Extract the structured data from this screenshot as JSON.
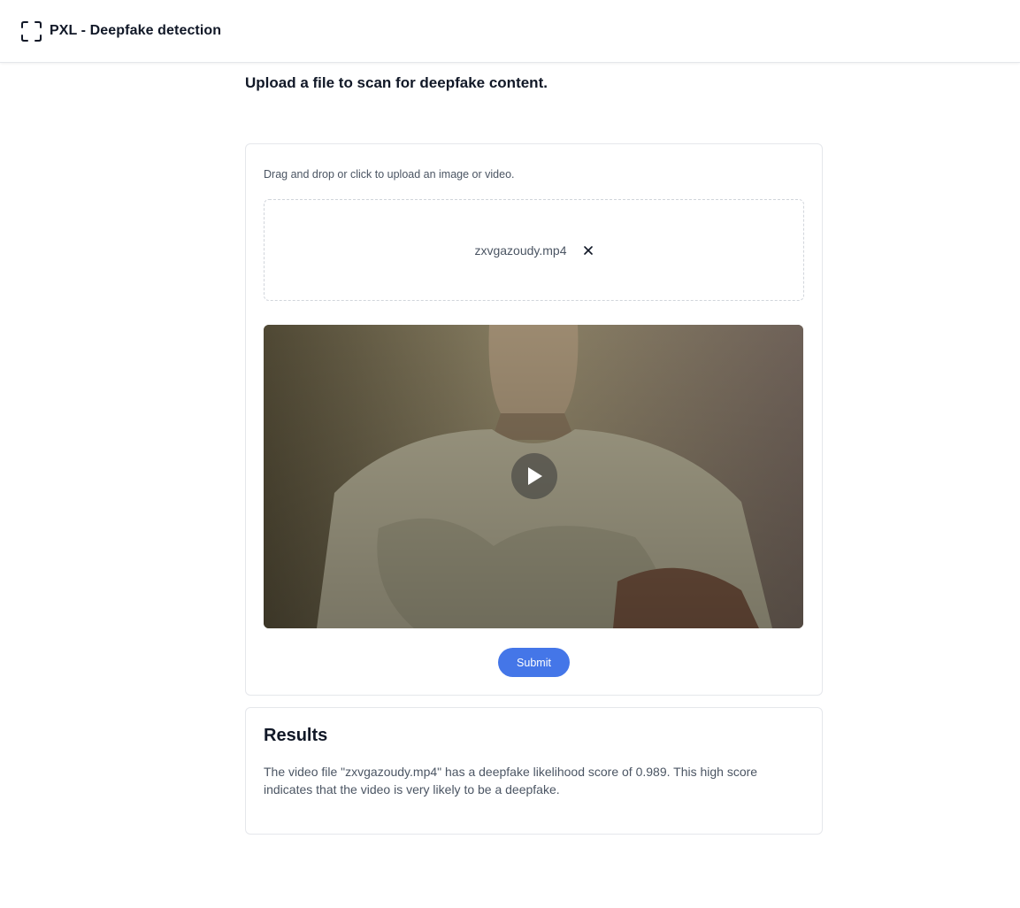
{
  "header": {
    "app_title": "PXL - Deepfake detection",
    "logo_icon": "scan-frame-icon"
  },
  "main": {
    "heading": "Upload a file to scan for deepfake content."
  },
  "upload": {
    "hint": "Drag and drop or click to upload an image or video.",
    "file_name": "zxvgazoudy.mp4",
    "remove_icon": "close-icon",
    "play_icon": "play-icon",
    "submit_label": "Submit"
  },
  "results": {
    "title": "Results",
    "text": "The video file \"zxvgazoudy.mp4\" has a deepfake likelihood score of 0.989. This high score indicates that the video is very likely to be a deepfake."
  },
  "colors": {
    "accent": "#4476e8",
    "border": "#e5e7eb",
    "muted_text": "#4b5563"
  }
}
